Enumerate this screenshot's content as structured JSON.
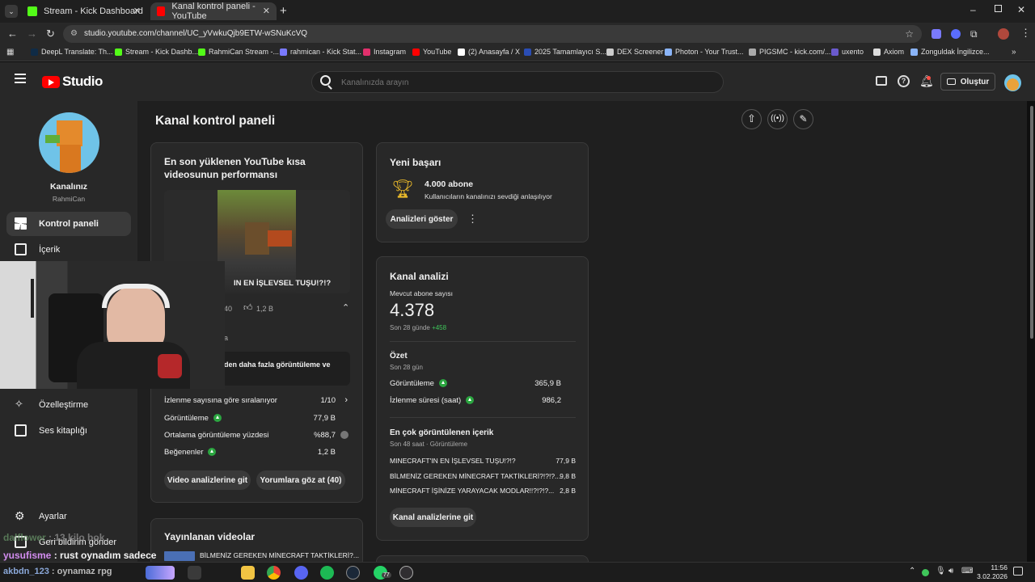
{
  "browser": {
    "tabs": [
      {
        "title": "Stream - Kick Dashboard",
        "color": "#53fc18"
      },
      {
        "title": "Kanal kontrol paneli - YouTube",
        "color": "#ff0000"
      }
    ],
    "url": "studio.youtube.com/channel/UC_yVwkuQjb9ETW-wSNuKcVQ",
    "bookmarks": [
      {
        "label": "DeepL Translate: Th...",
        "color": "#0f2b46"
      },
      {
        "label": "Stream - Kick Dashb...",
        "color": "#53fc18"
      },
      {
        "label": "RahmiCan Stream -...",
        "color": "#53fc18"
      },
      {
        "label": "rahmican - Kick Stat...",
        "color": "#7a7aff"
      },
      {
        "label": "Instagram",
        "color": "#e1306c"
      },
      {
        "label": "YouTube",
        "color": "#ff0000"
      },
      {
        "label": "(2) Anasayfa / X",
        "color": "#ffffff"
      },
      {
        "label": "2025 Tamamlayıcı S...",
        "color": "#2a4db5"
      },
      {
        "label": "DEX Screener",
        "color": "#cccccc"
      },
      {
        "label": "Photon - Your Trust...",
        "color": "#8ab4f8"
      },
      {
        "label": "PIGSMC - kick.com/...",
        "color": "#aaaaaa"
      },
      {
        "label": "uxento",
        "color": "#6a5acd"
      },
      {
        "label": "Axiom",
        "color": "#dddddd"
      },
      {
        "label": "Zonguldak İngilizce...",
        "color": "#8ab4f8"
      }
    ]
  },
  "studio": {
    "logo": "Studio",
    "search_placeholder": "Kanalınızda arayın",
    "create_label": "Oluştur"
  },
  "sidebar": {
    "channel_title": "Kanalınız",
    "channel_name": "RahmiCan",
    "items": [
      {
        "label": "Kontrol paneli"
      },
      {
        "label": "İçerik"
      },
      {
        "label": "Özelleştirme"
      },
      {
        "label": "Ses kitaplığı"
      },
      {
        "label": "Ayarlar"
      },
      {
        "label": "Geri bildirim gönder"
      }
    ]
  },
  "dashboard": {
    "title": "Kanal kontrol paneli",
    "shorts_card": {
      "title": "En son yüklenen YouTube kısa videosunun performansı",
      "video_title_partial": "IN EN İŞLEVSEL TUŞU!?!?",
      "views_partial": "40",
      "likes": "1,2 B",
      "notice_partial": "den daha fazla görüntüleme ve",
      "sub_partial": "a",
      "stats": [
        {
          "label": "İzlenme sayısına göre sıralanıyor",
          "value": "1/10",
          "indicator": "chevron"
        },
        {
          "label": "Görüntüleme",
          "value": "77,9 B",
          "indicator": "up"
        },
        {
          "label": "Ortalama görüntüleme yüzdesi",
          "value": "%88,7",
          "indicator": "down"
        },
        {
          "label": "Beğenenler",
          "value": "1,2 B",
          "indicator": "up"
        }
      ],
      "btn_analytics": "Video analizlerine git",
      "btn_comments": "Yorumlara göz at (40)"
    },
    "published_card": {
      "title": "Yayınlanan videolar",
      "first_video": "BİLMENİZ GEREKEN MİNECRAFT TAKTİKLERİ?..."
    },
    "achievement_card": {
      "title": "Yeni başarı",
      "headline": "4.000 abone",
      "description": "Kullanıcıların kanalınızı sevdiği anlaşılıyor",
      "button": "Analizleri göster"
    },
    "analytics_card": {
      "title": "Kanal analizi",
      "current_subs_label": "Mevcut abone sayısı",
      "current_subs": "4.378",
      "period_label": "Son 28 günde",
      "period_change": "+458",
      "summary_title": "Özet",
      "summary_period": "Son 28 gün",
      "summary_rows": [
        {
          "label": "Görüntüleme",
          "value": "365,9 B"
        },
        {
          "label": "İzlenme süresi (saat)",
          "value": "986,2"
        }
      ],
      "top_title": "En çok görüntülenen içerik",
      "top_period": "Son 48 saat · Görüntüleme",
      "top_rows": [
        {
          "label": "MINECRAFT'IN EN İŞLEVSEL TUŞU!?!?",
          "value": "77,9 B"
        },
        {
          "label": "BİLMENİZ GEREKEN MİNECRAFT TAKTİKLERİ?!?!?...",
          "value": "9,8 B"
        },
        {
          "label": "MİNECRAFT İŞİNİZE YARAYACAK MODLAR!!?!?!?...",
          "value": "2,8 B"
        }
      ],
      "button": "Kanal analizlerine git"
    }
  },
  "stream_overlay": {
    "chat": [
      {
        "user": "dalflower",
        "text": "13 kilo bok"
      },
      {
        "user": "yusufisme",
        "text": "rust oynadım sadece"
      },
      {
        "user": "akbdn_123",
        "text": "oynamaz rpg"
      }
    ]
  },
  "taskbar": {
    "time": "11:56",
    "date": "3.02.2026",
    "badge": "77"
  }
}
